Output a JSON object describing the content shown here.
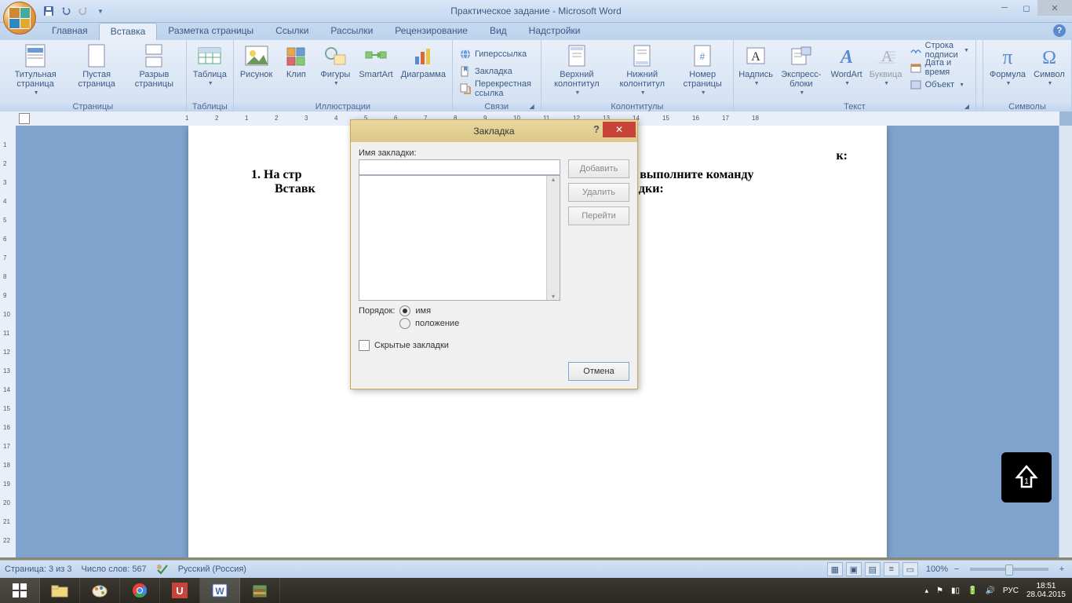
{
  "title": "Практическое задание - Microsoft Word",
  "tabs": [
    "Главная",
    "Вставка",
    "Разметка страницы",
    "Ссылки",
    "Рассылки",
    "Рецензирование",
    "Вид",
    "Надстройки"
  ],
  "active_tab": 1,
  "ribbon": {
    "pages": {
      "label": "Страницы",
      "cover": "Титульная страница",
      "blank": "Пустая страница",
      "break": "Разрыв страницы"
    },
    "tables": {
      "label": "Таблицы",
      "table": "Таблица"
    },
    "illus": {
      "label": "Иллюстрации",
      "pic": "Рисунок",
      "clip": "Клип",
      "shapes": "Фигуры",
      "smartart": "SmartArt",
      "chart": "Диаграмма"
    },
    "links": {
      "label": "Связи",
      "hyper": "Гиперссылка",
      "bookmark": "Закладка",
      "xref": "Перекрестная ссылка"
    },
    "headers": {
      "label": "Колонтитулы",
      "top": "Верхний колонтитул",
      "bottom": "Нижний колонтитул",
      "pagenum": "Номер страницы"
    },
    "text": {
      "label": "Текст",
      "textbox": "Надпись",
      "quick": "Экспресс-блоки",
      "wordart": "WordArt",
      "dropcap": "Буквица",
      "sig": "Строка подписи",
      "datetime": "Дата и время",
      "object": "Объект"
    },
    "symbols": {
      "label": "Символы",
      "formula": "Формула",
      "symbol": "Символ"
    }
  },
  "doc": {
    "line1_a": "1.  На стр",
    "line1_b": "овом, выполните команду",
    "line2_a": "Вставк",
    "line2_b": "акладки:",
    "header_fragment": "к:"
  },
  "dialog": {
    "title": "Закладка",
    "name_label": "Имя закладки:",
    "name_value": "",
    "sort_label": "Порядок:",
    "sort_name": "имя",
    "sort_pos": "положение",
    "hidden": "Скрытые закладки",
    "add": "Добавить",
    "del": "Удалить",
    "goto": "Перейти",
    "cancel": "Отмена"
  },
  "status": {
    "page": "Страница: 3 из 3",
    "words": "Число слов: 567",
    "lang": "Русский (Россия)",
    "zoom": "100%"
  },
  "tray": {
    "lang": "РУС",
    "time": "18:51",
    "date": "28.04.2015"
  },
  "hruler_nums": [
    "1",
    "2",
    "1",
    "2",
    "3",
    "4",
    "5",
    "6",
    "7",
    "8",
    "9",
    "10",
    "11",
    "12",
    "13",
    "14",
    "15",
    "16",
    "17",
    "18"
  ]
}
